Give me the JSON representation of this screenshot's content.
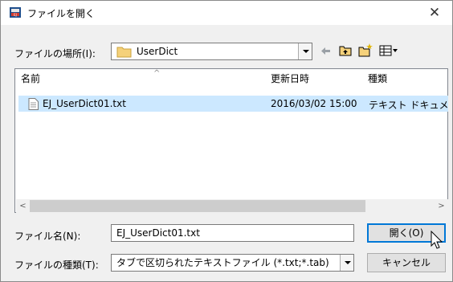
{
  "title_bar": {
    "icon": "app-dictionary-icon",
    "title": "ファイルを開く",
    "close_glyph": "✕"
  },
  "location": {
    "label": "ファイルの場所(I):",
    "value": "UserDict",
    "icons": [
      "back-arrow-icon",
      "up-folder-icon",
      "new-folder-icon",
      "view-menu-icon"
    ]
  },
  "file_list": {
    "columns": [
      "名前",
      "更新日時",
      "種類"
    ],
    "rows": [
      {
        "name": "EJ_UserDict01.txt",
        "modified": "2016/03/02 15:00",
        "type": "テキスト ドキュメント"
      }
    ],
    "selected_row": 0
  },
  "filename": {
    "label": "ファイル名(N):",
    "value": "EJ_UserDict01.txt"
  },
  "filetype": {
    "label": "ファイルの種類(T):",
    "value": "タブで区切られたテキストファイル (*.txt;*.tab)"
  },
  "buttons": {
    "open": "開く(O)",
    "cancel": "キャンセル"
  },
  "colors": {
    "selection": "#cce8ff",
    "default_button_border": "#0078d7",
    "dialog_background": "#f0f0f0"
  }
}
